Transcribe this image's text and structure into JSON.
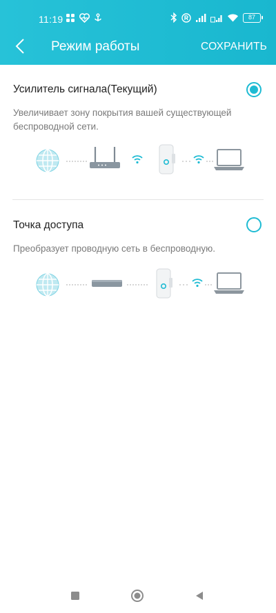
{
  "status_bar": {
    "time": "11:19",
    "battery": "87"
  },
  "header": {
    "title": "Режим работы",
    "save_label": "СОХРАНИТЬ",
    "accent_color": "#1ebbd3"
  },
  "modes": [
    {
      "title": "Усилитель сигнала(Текущий)",
      "description": "Увеличивает зону покрытия вашей существующей беспроводной сети.",
      "selected": true
    },
    {
      "title": "Точка доступа",
      "description": "Преобразует проводную сеть в беспроводную.",
      "selected": false
    }
  ],
  "nav": [
    "square-icon",
    "circle-icon",
    "triangle-back-icon"
  ]
}
